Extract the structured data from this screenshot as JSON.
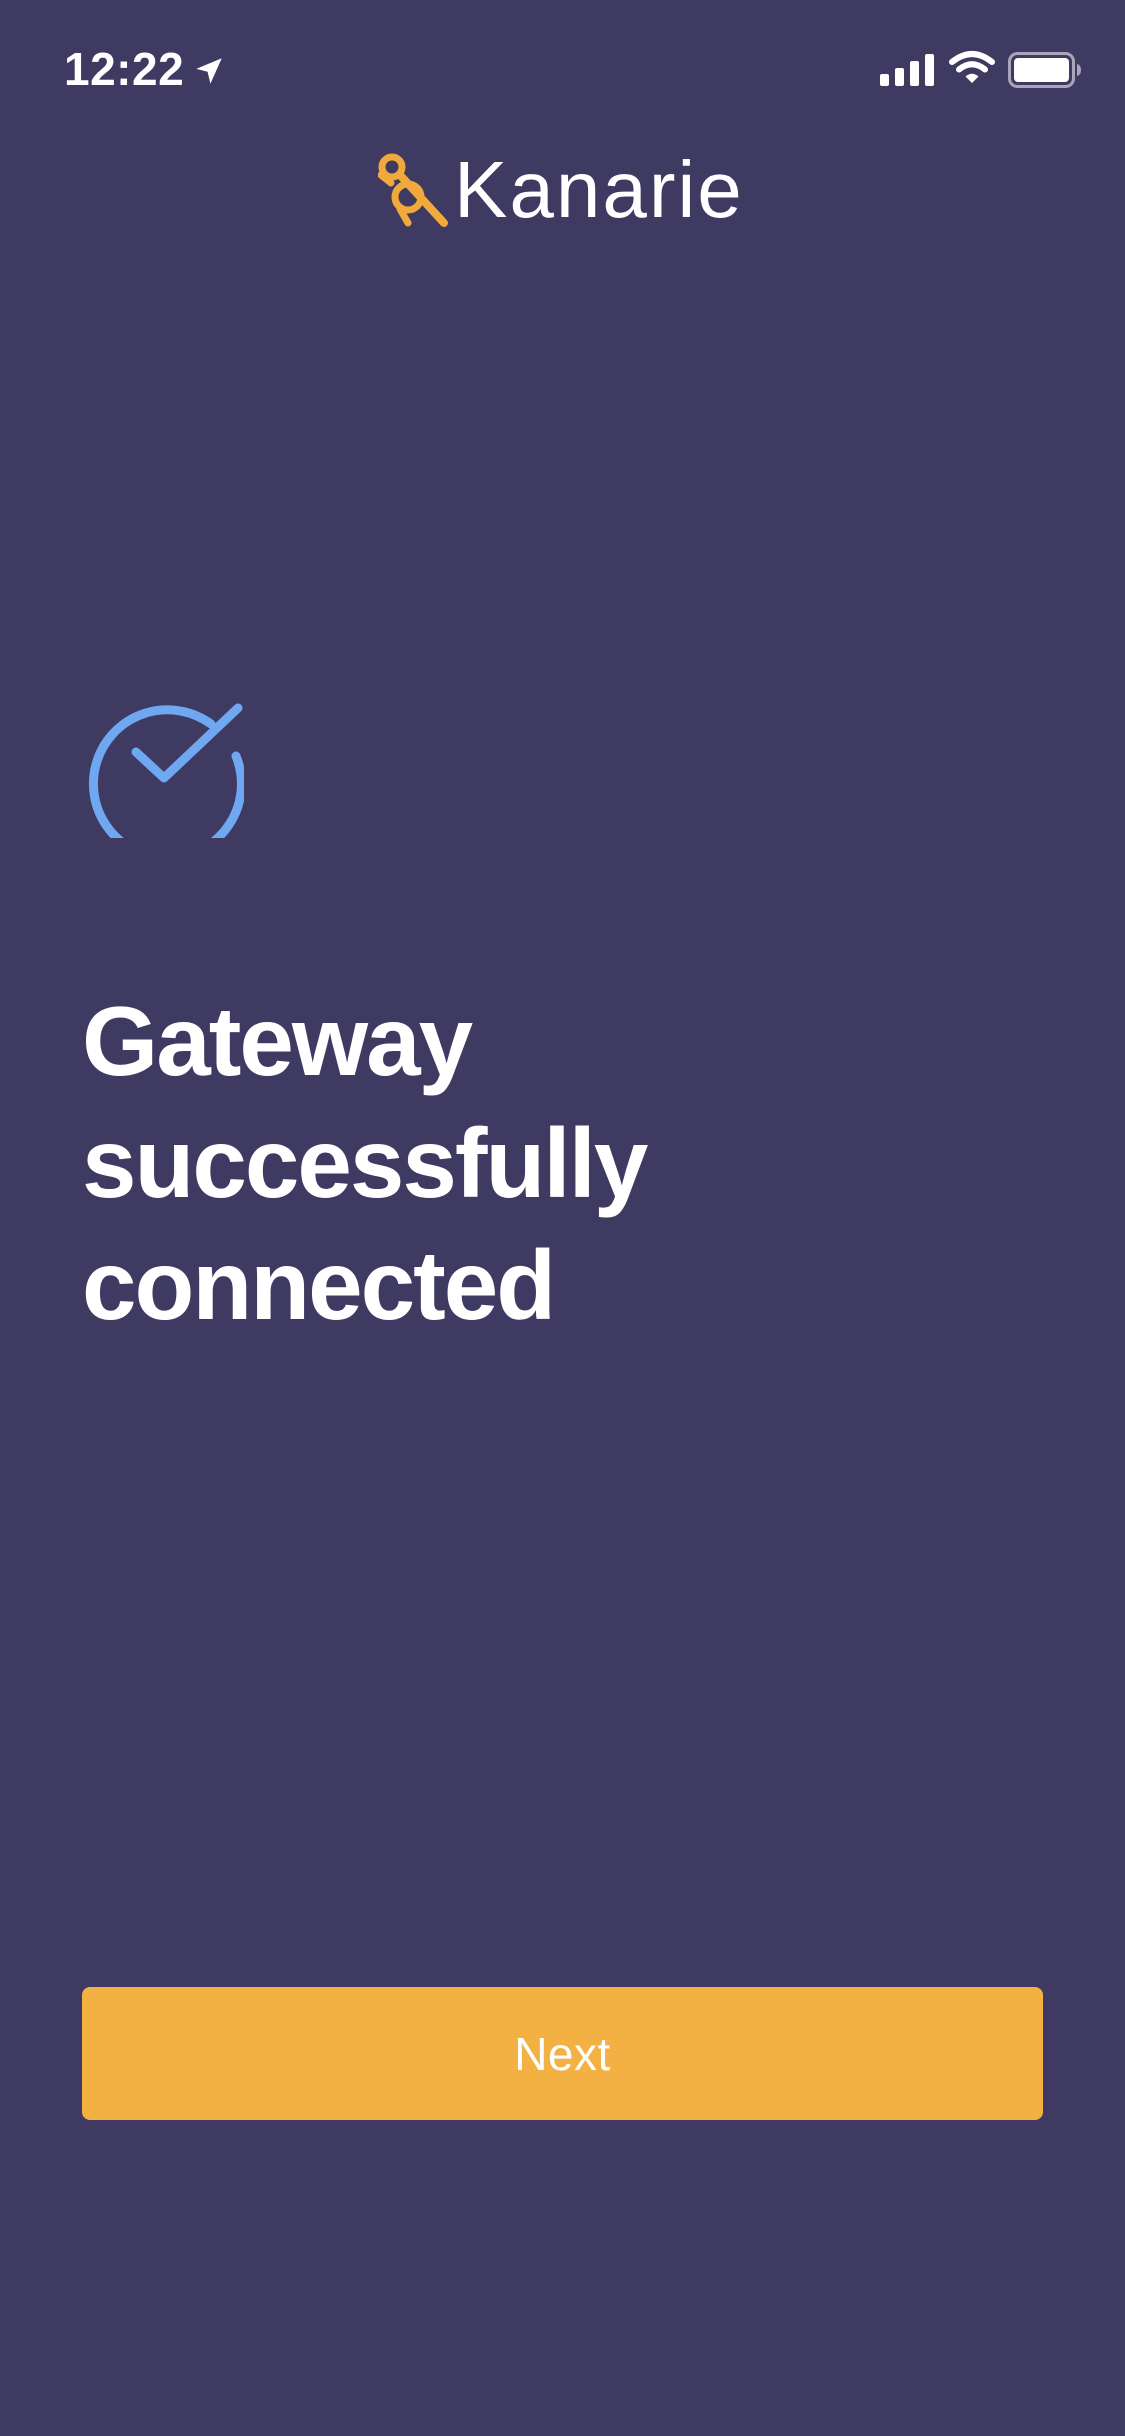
{
  "status_bar": {
    "time": "12:22",
    "icons": [
      "location-arrow-icon",
      "cellular-signal-icon",
      "wifi-icon",
      "battery-icon"
    ]
  },
  "header": {
    "logo_text": "Kanarie",
    "logo_icon": "canary-bird-icon",
    "logo_color": "#f2a93b"
  },
  "main": {
    "status_icon": "check-circle-icon",
    "status_icon_color": "#6fa8f0",
    "headline_lines": [
      "Gateway",
      "successfully",
      "connected"
    ]
  },
  "footer": {
    "next_label": "Next",
    "button_color": "#f2b142"
  },
  "colors": {
    "background": "#3f3a62",
    "text": "#ffffff"
  }
}
